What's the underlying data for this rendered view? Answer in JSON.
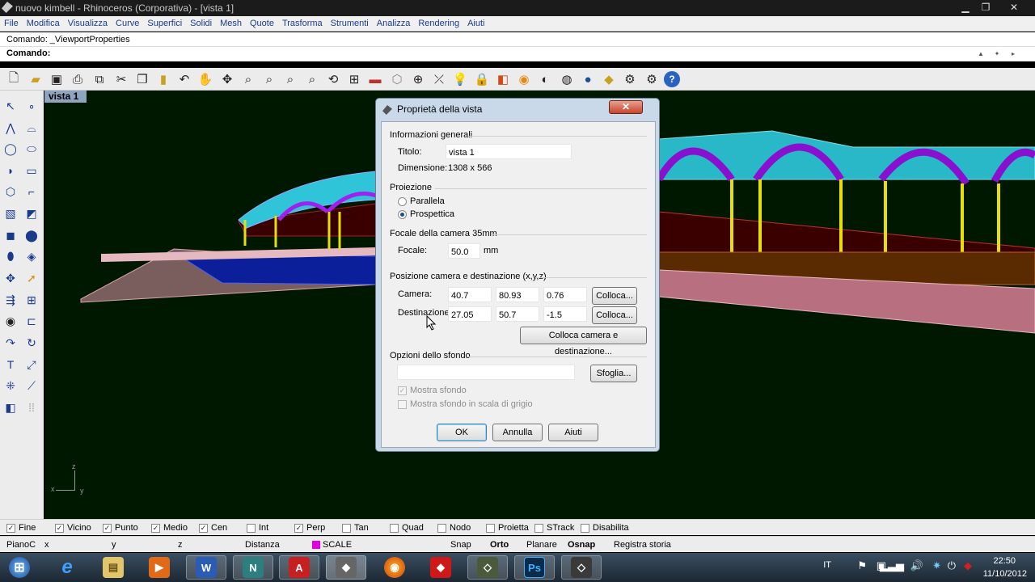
{
  "titlebar": {
    "title": "nuovo kimbell - Rhinoceros (Corporativa) - [vista 1]",
    "min": "▁",
    "max": "❐",
    "close": "✕"
  },
  "menu": [
    "File",
    "Modifica",
    "Visualizza",
    "Curve",
    "Superfici",
    "Solidi",
    "Mesh",
    "Quote",
    "Trasforma",
    "Strumenti",
    "Analizza",
    "Rendering",
    "Aiuti"
  ],
  "command": {
    "history": "Comando: _ViewportProperties",
    "prompt": "Comando:",
    "value": ""
  },
  "viewport": {
    "tab": "vista 1",
    "axis_z": "z",
    "axis_x": "x",
    "axis_y": "y"
  },
  "dialog": {
    "title": "Proprietà della vista",
    "close": "✕",
    "general_header": "Informazioni generali",
    "titolo_label": "Titolo:",
    "titolo_value": "vista 1",
    "dimensione_label": "Dimensione:",
    "dimensione_value": "1308 x 566",
    "proiezione_header": "Proiezione",
    "parallela": "Parallela",
    "prospettica": "Prospettica",
    "focale_header": "Focale della camera 35mm",
    "focale_label": "Focale:",
    "focale_value": "50.0",
    "focale_unit": "mm",
    "posizione_header": "Posizione camera e destinazione (x,y,z)",
    "camera_label": "Camera:",
    "camera": [
      "40.7",
      "80.93",
      "0.76"
    ],
    "destinazione_label": "Destinazione:",
    "destinazione": [
      "27.05",
      "50.7",
      "-1.5"
    ],
    "colloca": "Colloca...",
    "colloca_entrambi": "Colloca camera e destinazione...",
    "sfondo_header": "Opzioni dello sfondo",
    "sfondo_value": "",
    "sfoglia": "Sfoglia...",
    "mostra_sfondo": "Mostra sfondo",
    "mostra_grigio": "Mostra sfondo in scala di grigio",
    "ok": "OK",
    "annulla": "Annulla",
    "aiuti": "Aiuti"
  },
  "osnap": [
    {
      "label": "Fine",
      "checked": true
    },
    {
      "label": "Vicino",
      "checked": true
    },
    {
      "label": "Punto",
      "checked": true
    },
    {
      "label": "Medio",
      "checked": true
    },
    {
      "label": "Cen",
      "checked": true
    },
    {
      "label": "Int",
      "checked": false
    },
    {
      "label": "Perp",
      "checked": true
    },
    {
      "label": "Tan",
      "checked": false
    },
    {
      "label": "Quad",
      "checked": false
    },
    {
      "label": "Nodo",
      "checked": false
    },
    {
      "label": "Proietta",
      "checked": false
    },
    {
      "label": "STrack",
      "checked": false
    },
    {
      "label": "Disabilita",
      "checked": false
    }
  ],
  "coords": {
    "plane": "PianoC",
    "x": "x",
    "y": "y",
    "z": "z",
    "distanza": "Distanza",
    "layer": "SCALE",
    "layer_color": "#e000e0",
    "snap": "Snap",
    "orto": "Orto",
    "planare": "Planare",
    "osnap": "Osnap",
    "registra": "Registra storia"
  },
  "tray": {
    "lang": "IT",
    "time": "22:50",
    "date": "11/10/2012"
  },
  "taskbar": {
    "start": "⊞",
    "ie": "e",
    "explorer": "▤",
    "media": "▶",
    "word": "W",
    "n": "N",
    "acrobat": "A",
    "rhino": "◆",
    "firefox": "◉",
    "shield": "◆",
    "app2": "◇",
    "ps": "Ps",
    "app3": "◇"
  }
}
